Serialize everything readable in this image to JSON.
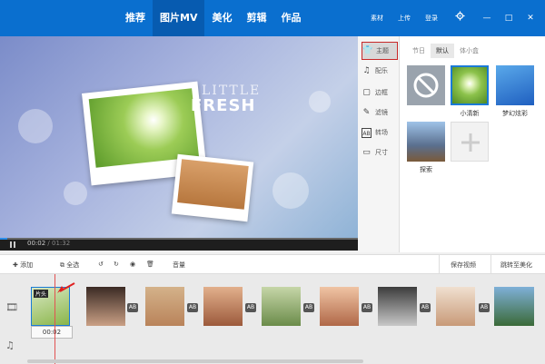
{
  "nav": {
    "items": [
      "推荐",
      "图片MV",
      "美化",
      "剪辑",
      "作品"
    ],
    "active_index": 1
  },
  "top_tools": {
    "material": "素材",
    "upload": "上传",
    "login": "登录"
  },
  "window_controls": {
    "minimize": "—",
    "maximize": "□",
    "close": "✕"
  },
  "preview": {
    "overlay_small": "LITTLE",
    "overlay_big": "FRESH",
    "current_time": "00:02",
    "total_time": "/ 01:32",
    "progress": 0.02
  },
  "sidebar": {
    "items": [
      {
        "label": "主题",
        "icon": "tshirt-icon",
        "active": true
      },
      {
        "label": "配乐",
        "icon": "music-note-icon",
        "active": false
      },
      {
        "label": "边框",
        "icon": "frame-icon",
        "active": false
      },
      {
        "label": "滤镜",
        "icon": "filter-icon",
        "active": false
      },
      {
        "label": "转场",
        "icon": "transition-icon",
        "active": false
      },
      {
        "label": "尺寸",
        "icon": "size-icon",
        "active": false
      }
    ]
  },
  "panel": {
    "subtabs": [
      "节日",
      "默认",
      "体小盒"
    ],
    "active_subtab": 1,
    "themes": [
      {
        "label": "",
        "kind": "none"
      },
      {
        "label": "小清新",
        "kind": "dandelion",
        "selected": true
      },
      {
        "label": "梦幻炫彩",
        "kind": "blue-wave"
      },
      {
        "label": "探索",
        "kind": "hiker"
      },
      {
        "label": "",
        "kind": "add"
      }
    ]
  },
  "toolbar": {
    "add": "添加",
    "select_all": "全选",
    "volume": "音量",
    "save_video": "保存视频",
    "jump_to_beautify": "跳转至美化"
  },
  "timeline": {
    "first_clip_time": "00:02",
    "first_clip_tag": "片头",
    "transition_label": "AB",
    "clip_count": 9
  },
  "colors": {
    "titlebar": "#0a6fcf",
    "nav_active": "#075bb0",
    "progress_fill": "#2d8de8",
    "selection_border": "#c82828",
    "cursor": "#e25252"
  }
}
